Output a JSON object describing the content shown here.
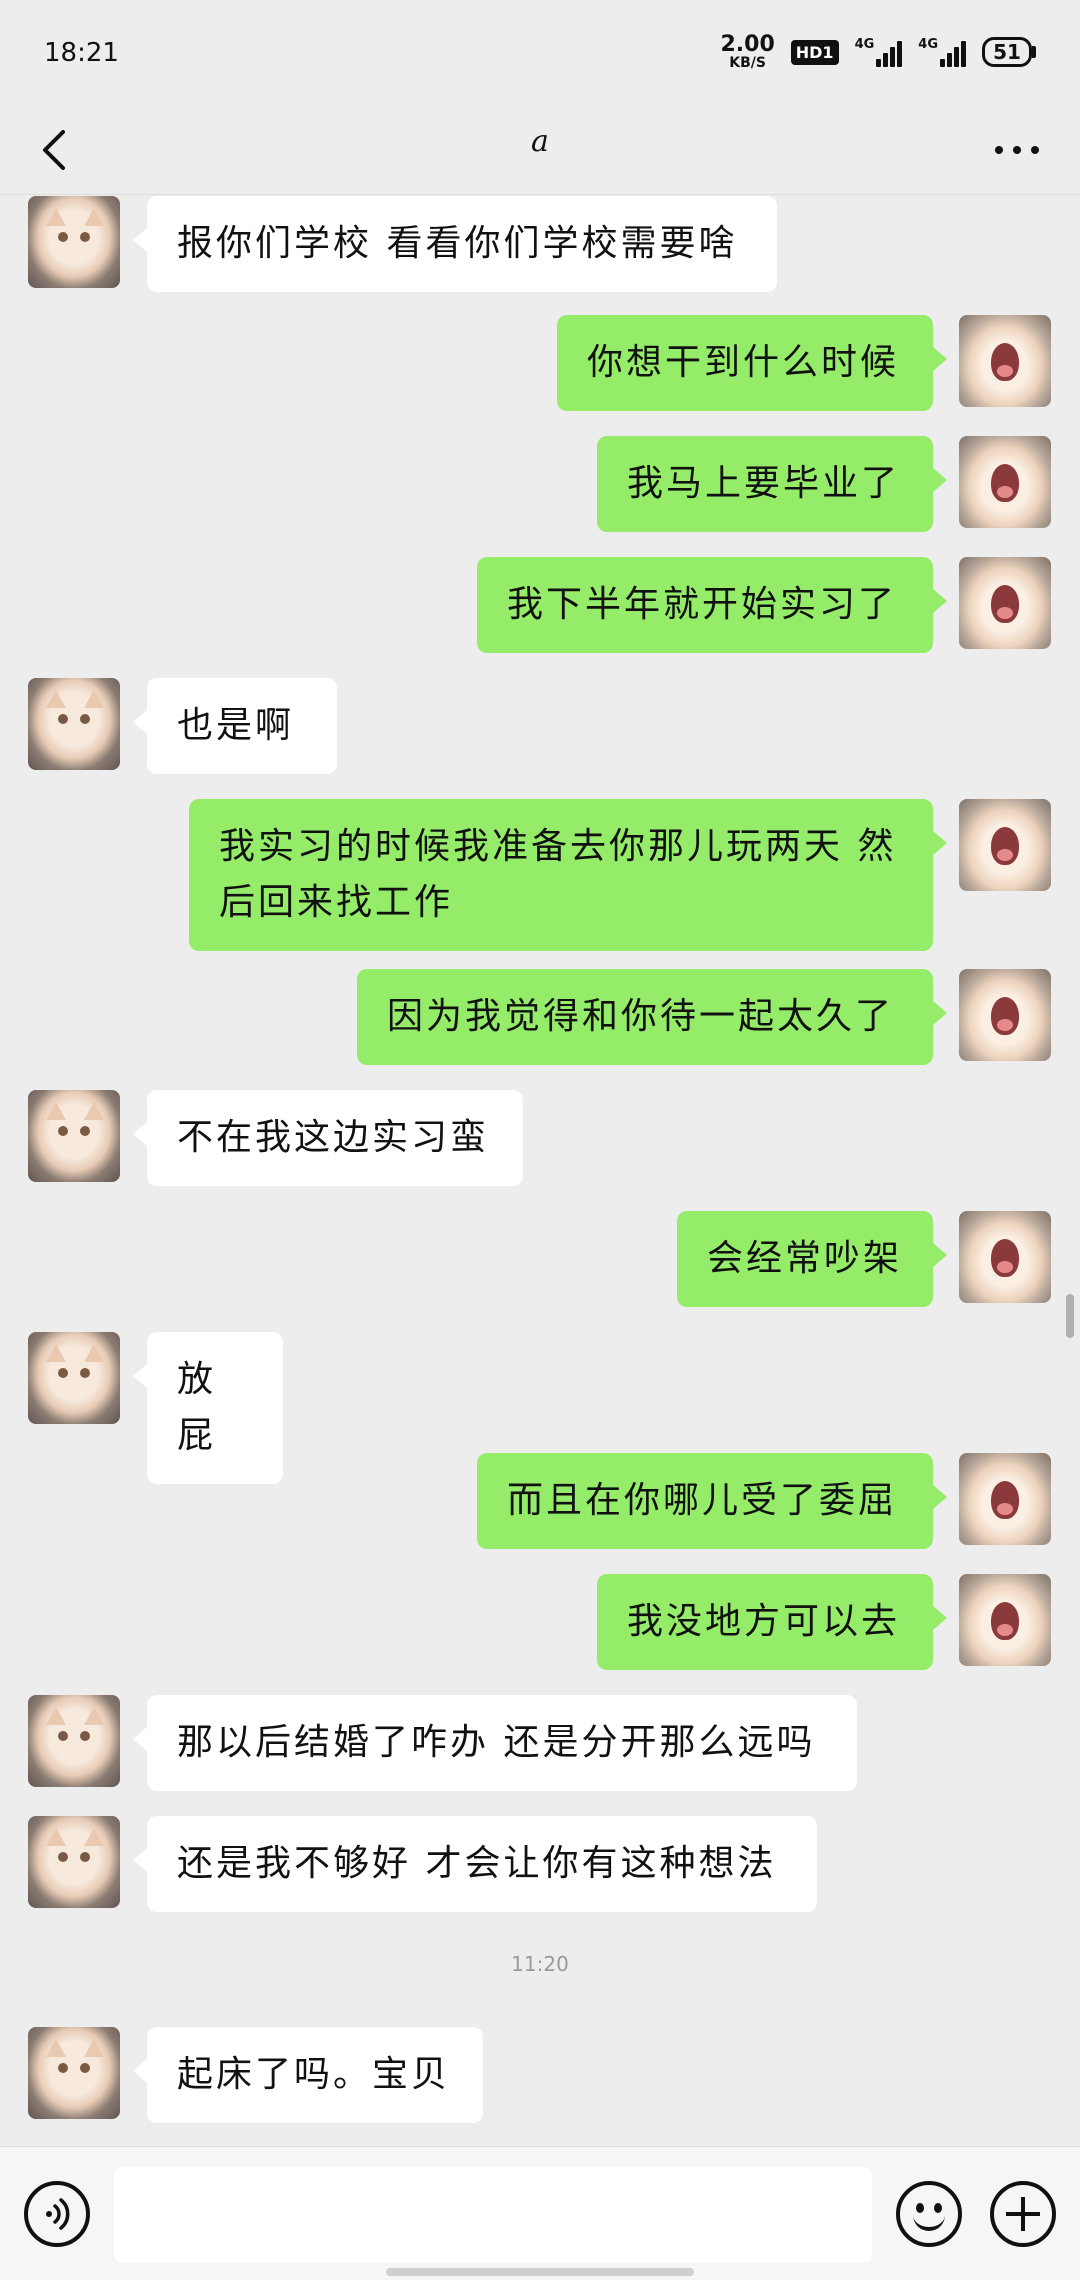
{
  "status_bar": {
    "time": "18:21",
    "net_speed": "2.00",
    "net_unit": "KB/S",
    "hd_badge": "HD1",
    "signal_1_label": "4G",
    "signal_2_label": "4G",
    "battery": "51"
  },
  "header": {
    "title": "a",
    "back_icon": "chevron-left-icon",
    "more_icon": "more-dots-icon"
  },
  "messages": [
    {
      "side": "peer",
      "text": "报你们学校 看看你们学校需要啥"
    },
    {
      "side": "self",
      "text": "你想干到什么时候"
    },
    {
      "side": "self",
      "text": "我马上要毕业了"
    },
    {
      "side": "self",
      "text": "我下半年就开始实习了"
    },
    {
      "side": "peer",
      "text": "也是啊"
    },
    {
      "side": "self",
      "text": "我实习的时候我准备去你那儿玩两天 然后回来找工作"
    },
    {
      "side": "self",
      "text": "因为我觉得和你待一起太久了"
    },
    {
      "side": "peer",
      "text": "不在我这边实习蛮"
    },
    {
      "side": "self",
      "text": "会经常吵架"
    },
    {
      "side": "peer",
      "text": "放屁"
    },
    {
      "side": "self",
      "text": "而且在你哪儿受了委屈"
    },
    {
      "side": "self",
      "text": "我没地方可以去"
    },
    {
      "side": "peer",
      "text": "那以后结婚了咋办 还是分开那么远吗"
    },
    {
      "side": "peer",
      "text": "还是我不够好 才会让你有这种想法"
    },
    {
      "side": "peer",
      "text": "起床了吗。宝贝"
    }
  ],
  "timestamp": "11:20",
  "input": {
    "value": "",
    "voice_icon": "voice-icon",
    "emoji_icon": "emoji-icon",
    "plus_icon": "plus-icon"
  },
  "colors": {
    "background": "#ededed",
    "self_bubble": "#95ec69",
    "peer_bubble": "#ffffff"
  }
}
